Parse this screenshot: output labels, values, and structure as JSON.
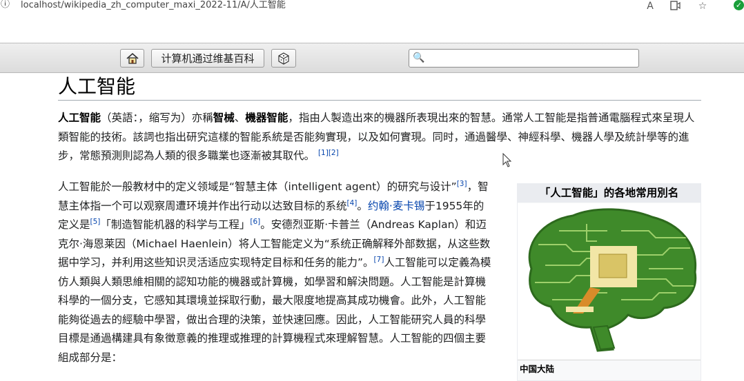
{
  "browser": {
    "url": "localhost/wikipedia_zh_computer_maxi_2022-11/A/人工智能",
    "icons": [
      "info-icon",
      "read-aloud-icon",
      "immersive-reader-icon",
      "favorites-icon",
      "verified-badge-icon"
    ]
  },
  "toolbar": {
    "home_icon": "⌂",
    "main_page_label": "计算机通过维基百科",
    "random_icon": "⚄",
    "search_icon": "🔍",
    "search_value": ""
  },
  "article": {
    "title": "人工智能",
    "p1": {
      "bold1": "人工智能",
      "t1": "（英語：，缩写为）亦稱",
      "bold2": "智械",
      "t2": "、",
      "bold3": "機器智能",
      "t3": "，指由人製造出來的機器所表現出來的智慧。通常人工智能是指普通電腦程式來呈現人類智能的技術。該詞也指出研究這樣的智能系統是否能夠實現，以及如何實現。同时，通過醫學、神經科學、機器人學及統計學等的進步，常態預測則認為人類的很多職業也逐漸被其取代。",
      "ref1": "[1]",
      "ref2": "[2]"
    },
    "p2": {
      "t1": "人工智能於一般教材中的定义领域是“智慧主体（intelligent agent）的研究与设计”",
      "ref3": "[3]",
      "t2": "，智慧主体指一个可以观察周遭环境并作出行动以达致目标的系统",
      "ref4": "[4]",
      "t3": "。",
      "link1": "约翰·麦卡锡",
      "t4": "于1955年的定义是",
      "ref5": "[5]",
      "t5": "「制造智能机器的科学与工程」",
      "ref6": "[6]",
      "t6": "。安德烈亚斯·卡普兰（Andreas Kaplan）和迈克尔·海恩莱因（Michael Haenlein）将人工智能定义为“系统正确解释外部数据，从这些数据中学习，并利用这些知识灵活适应实现特定目标和任务的能力”。",
      "ref7": "[7]",
      "t7": "人工智能可以定義為模仿人類與人類思維相關的認知功能的機器或計算機，如學習和解決問題。人工智能是計算機科學的一個分支，它感知其環境並採取行動，最大限度地提高其成功機會。此外，人工智能能夠從過去的經驗中學習，做出合理的決策，並快速回應。因此，人工智能研究人員的科學目標是通過構建具有象徵意義的推理或推理的計算機程式來理解智慧。人工智能的四個主要組成部分是："
    }
  },
  "infobox": {
    "title": "「人工智能」的各地常用別名",
    "image": "brain-circuit-image",
    "row1_label": "中国大陆"
  },
  "colors": {
    "link": "#0645ad",
    "text": "#202122",
    "toolbar": "#e4e4e4",
    "brain_green": "#3f8a2a"
  }
}
